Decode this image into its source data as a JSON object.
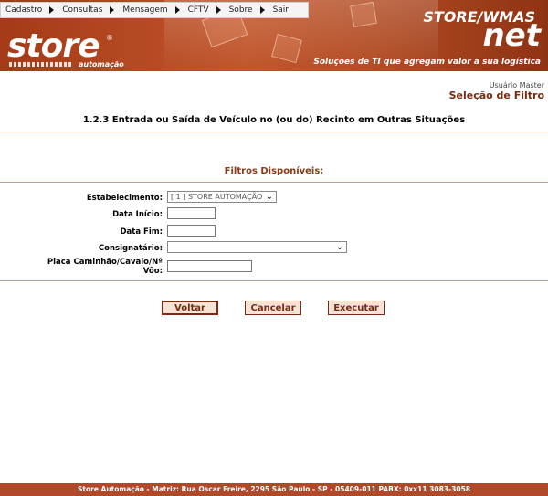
{
  "menu": {
    "items": [
      {
        "label": "Cadastro"
      },
      {
        "label": "Consultas"
      },
      {
        "label": "Mensagem"
      },
      {
        "label": "CFTV"
      },
      {
        "label": "Sobre"
      },
      {
        "label": "Sair"
      }
    ]
  },
  "brand": {
    "logo_text": "store",
    "logo_sub": "automação",
    "product_top": "STORE/WMAS",
    "product_main": "net",
    "tagline": "Soluções de TI que agregam valor a sua logística"
  },
  "header": {
    "user": "Usuário Master",
    "section": "Seleção de Filtro"
  },
  "page": {
    "title": "1.2.3 Entrada ou Saída de Veículo no (ou do) Recinto em Outras Situações",
    "filters_title": "Filtros Disponíveis:"
  },
  "form": {
    "estabelecimento_label": "Estabelecimento:",
    "estabelecimento_value": "[ 1 ] STORE AUTOMAÇÃO",
    "data_inicio_label": "Data Início:",
    "data_inicio_value": "",
    "data_fim_label": "Data Fim:",
    "data_fim_value": "",
    "consignatario_label": "Consignatário:",
    "consignatario_value": "",
    "placa_label_line1": "Placa Caminhão/Cavalo/Nº",
    "placa_label_line2": "Vôo:",
    "placa_value": ""
  },
  "buttons": {
    "voltar": "Voltar",
    "cancelar": "Cancelar",
    "executar": "Executar"
  },
  "footer": {
    "text": "Store Automação - Matriz: Rua Oscar Freire, 2295 São Paulo - SP - 05409-011 PABX: 0xx11 3083-3058"
  },
  "colors": {
    "banner": "#b04a22",
    "accent": "#7a2a10",
    "button_bg": "#f6e3d6"
  }
}
